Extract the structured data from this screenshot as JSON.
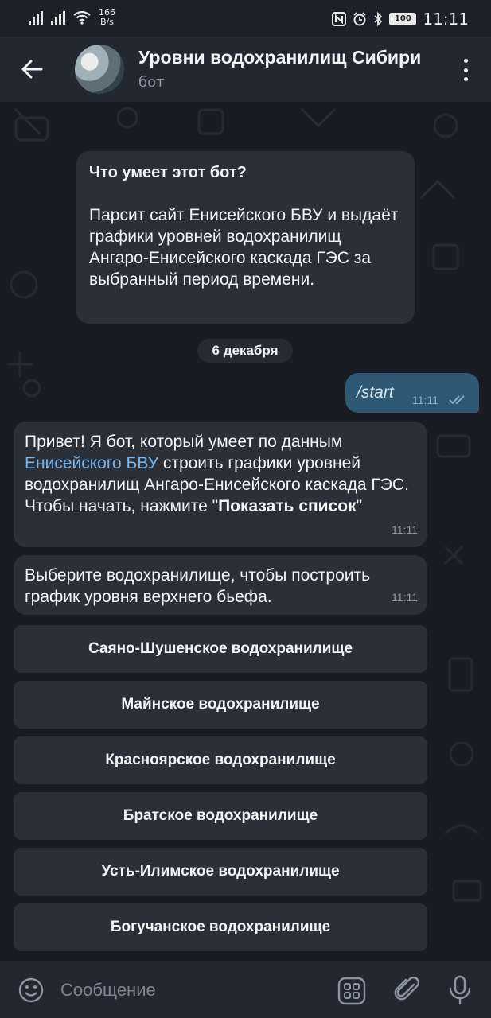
{
  "status_bar": {
    "net_speed_value": "166",
    "net_speed_unit": "B/s",
    "battery": "100",
    "time": "11:11"
  },
  "header": {
    "title": "Уровни водохранилищ Сибири",
    "subtitle": "бот",
    "icons": [
      "arrow-left-icon",
      "more-vertical-icon"
    ]
  },
  "chat": {
    "intro": {
      "title": "Что умеет этот бот?",
      "text": "Парсит сайт Енисейского БВУ и выдаёт графики уровней водохранилищ Ангаро-Енисейского каскада ГЭС за выбранный период времени."
    },
    "date_separator": "6 декабря",
    "outgoing": {
      "text": "/start",
      "time": "11:11"
    },
    "messages": [
      {
        "text_before": "Привет! Я бот, который умеет по данным ",
        "link": "Енисейского БВУ",
        "text_after": " строить графики уровней водохранилищ Ангаро-Енисейского каскада ГЭС. Чтобы начать, нажмите \"",
        "bold": "Показать список",
        "text_end": "\"",
        "time": "11:11"
      },
      {
        "text": "Выберите водохранилище, чтобы построить график уровня верхнего бьефа.",
        "time": "11:11"
      }
    ],
    "keyboard": [
      "Саяно-Шушенское водохранилище",
      "Майнское водохранилище",
      "Красноярское водохранилище",
      "Братское водохранилище",
      "Усть-Илимское водохранилище",
      "Богучанское водохранилище"
    ]
  },
  "composer": {
    "placeholder": "Сообщение",
    "icons": [
      "emoji-icon",
      "bot-commands-icon",
      "paperclip-icon",
      "microphone-icon"
    ]
  },
  "colors": {
    "background": "#191c22",
    "bubble": "#2a2f38",
    "outgoing_bubble": "#2e5873",
    "link": "#7ab5ea",
    "header": "#222831"
  }
}
